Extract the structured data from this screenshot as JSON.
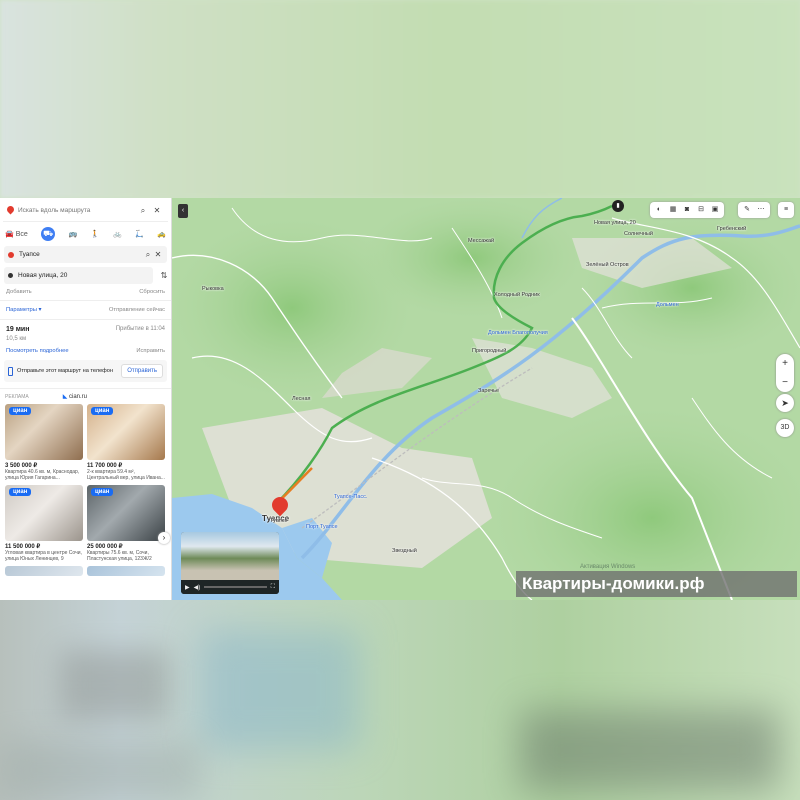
{
  "sidebar": {
    "search_placeholder": "Искать вдоль маршрута",
    "modes": [
      {
        "label": "Все",
        "icon": "car-bus-icon"
      },
      {
        "label": "",
        "icon": "car-icon"
      },
      {
        "label": "",
        "icon": "bus-icon"
      },
      {
        "label": "",
        "icon": "walk-icon"
      },
      {
        "label": "",
        "icon": "bike-icon"
      },
      {
        "label": "",
        "icon": "scooter-icon"
      },
      {
        "label": "",
        "icon": "taxi-icon"
      }
    ],
    "from": "Туапсе",
    "to": "Новая улица, 20",
    "add_label": "Добавить",
    "reset_label": "Сбросить",
    "params_label": "Параметры ▾",
    "departure_label": "Отправление сейчас",
    "route": {
      "duration": "19 мин",
      "arrival": "Прибытие в 11:04",
      "distance": "10,5 км",
      "details_link": "Посмотреть подробнее",
      "fix_link": "Исправить"
    },
    "send": {
      "text": "Отправьте этот маршрут на телефон",
      "button": "Отправить"
    },
    "ad": {
      "tag": "РЕКЛАМА",
      "source": "cian.ru",
      "logo": "циан",
      "items": [
        {
          "price": "3 500 000 ₽",
          "desc": "Квартира 40.6 кв. м, Краснодар, улица Юрия Гагарина..."
        },
        {
          "price": "11 700 000 ₽",
          "desc": "2-к квартира 59.4 м², Центральный вер, улица Ивана..."
        },
        {
          "price": "11 500 000 ₽",
          "desc": "Угловая квартира в центре Сочи, улица Юных Ленинцев, 9"
        },
        {
          "price": "25 000 000 ₽",
          "desc": "Квартиры 75.6 кв. м, Сочи, Пластунская улица, 123Ж/2"
        }
      ]
    }
  },
  "map": {
    "labels": {
      "messazhay": "Мессажай",
      "new_street": "Новая улица, 20",
      "green_island": "Зелёный Остров",
      "kholodny": "Холодный Родник",
      "dolmeny": "Дольмен Благополучия",
      "prigorodny": "Пригородный",
      "zarechye": "Заречье",
      "dolmen": "Дольмен",
      "tuapse": "Туапсе",
      "tuapse_pass": "Туапсе-Пасс.",
      "port": "Порт Туапсе",
      "zvezdny": "Звездный",
      "lesnaya": "Лесная",
      "grebensky": "Гребенский",
      "solnechny": "Солнечный",
      "rykovka": "Рыковка"
    },
    "pin_label": "Туапсе",
    "destination_icon": "destination-icon",
    "toolbar": [
      "layers-icon",
      "panorama-icon",
      "camera-icon",
      "transport-icon",
      "parking-icon"
    ],
    "toolbar2": [
      "ruler-icon",
      "more-icon"
    ],
    "menu_icon": "menu-icon",
    "zoom_in": "+",
    "zoom_out": "−",
    "locate": "➤",
    "threed": "3D",
    "activate_windows": "Активация Windows"
  },
  "watermark": "Квартиры-домики.рф"
}
